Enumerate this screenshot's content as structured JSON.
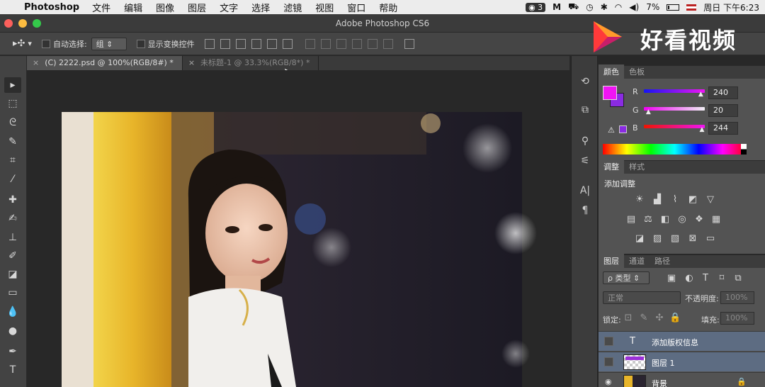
{
  "menubar": {
    "app_name": "Photoshop",
    "items": [
      "文件",
      "编辑",
      "图像",
      "图层",
      "文字",
      "选择",
      "滤镜",
      "视图",
      "窗口",
      "帮助"
    ],
    "status": {
      "badge": "3",
      "battery": "7%",
      "clock": "周日 下午6:23"
    }
  },
  "window": {
    "title": "Adobe Photoshop CS6"
  },
  "options": {
    "auto_select_label": "自动选择:",
    "auto_select_value": "组",
    "show_transform_label": "显示变换控件"
  },
  "tabs": [
    {
      "label": "(C) 2222.psd @ 100%(RGB/8#) *"
    },
    {
      "label": "未标题-1 @ 33.3%(RGB/8*) *"
    }
  ],
  "color_panel": {
    "tabs": [
      "颜色",
      "色板"
    ],
    "r_label": "R",
    "g_label": "G",
    "b_label": "B",
    "r": "240",
    "g": "20",
    "b": "244",
    "r_level": 0.94,
    "g_level": 0.08,
    "b_level": 0.96,
    "foreground": "#f014f4",
    "background": "#8a2be2"
  },
  "adjust_panel": {
    "tabs": [
      "调整",
      "样式"
    ],
    "add_label": "添加调整"
  },
  "layers_panel": {
    "tabs": [
      "图层",
      "通道",
      "路径"
    ],
    "filter_kind": "ρ 类型",
    "blend_mode": "正常",
    "opacity_label": "不透明度:",
    "opacity_value": "100%",
    "lock_label": "锁定:",
    "fill_label": "填充:",
    "fill_value": "100%",
    "layers": [
      {
        "name": "添加版权信息",
        "type": "text"
      },
      {
        "name": "图层 1",
        "type": "pixel"
      },
      {
        "name": "背景",
        "type": "background"
      }
    ]
  },
  "watermark": {
    "text": "好看视频"
  },
  "colors": {
    "accent": "#f014f4",
    "panel": "#535353",
    "dark": "#282828"
  }
}
